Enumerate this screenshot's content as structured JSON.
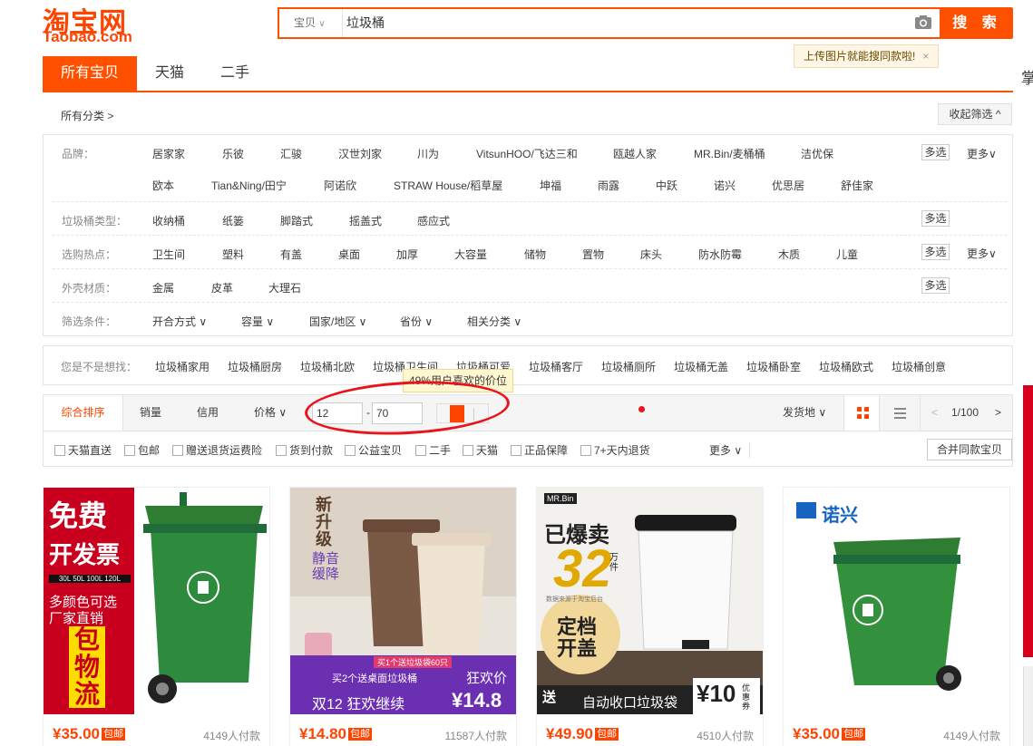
{
  "header": {
    "logo_cn": "淘宝网",
    "logo_en": "Taobao.com",
    "search_type": "宝贝",
    "search_value": "垃圾桶",
    "search_button": "搜 索",
    "upload_tip": "上传图片就能搜同款啦!",
    "tip_close": "×",
    "edge_char": "掌"
  },
  "tabs": [
    {
      "label": "所有宝贝",
      "active": true
    },
    {
      "label": "天猫",
      "active": false
    },
    {
      "label": "二手",
      "active": false
    }
  ],
  "filter": {
    "breadcrumb": "所有分类 >",
    "collapse_label": "收起筛选 ^",
    "multi_label": "多选",
    "more_label": "更多∨",
    "brand_label": "品牌：",
    "brands_row1": [
      "居家家",
      "乐彼",
      "汇骏",
      "汉世刘家",
      "川为",
      "VitsunHOO/飞达三和",
      "瓯越人家",
      "MR.Bin/麦桶桶",
      "洁优保"
    ],
    "brands_row2": [
      "欧本",
      "Tian&Ning/田宁",
      "阿诺欣",
      "STRAW House/稻草屋",
      "坤福",
      "雨露",
      "中跃",
      "诺兴",
      "优思居",
      "舒佳家"
    ],
    "type_label": "垃圾桶类型：",
    "types": [
      "收纳桶",
      "纸篓",
      "脚踏式",
      "摇盖式",
      "感应式"
    ],
    "hot_label": "选购热点：",
    "hots": [
      "卫生间",
      "塑料",
      "有盖",
      "桌面",
      "加厚",
      "大容量",
      "储物",
      "置物",
      "床头",
      "防水防霉",
      "木质",
      "儿童"
    ],
    "material_label": "外壳材质：",
    "materials": [
      "金属",
      "皮革",
      "大理石"
    ],
    "cond_label": "筛选条件：",
    "conds": [
      "开合方式 ∨",
      "容量 ∨",
      "国家/地区 ∨",
      "省份 ∨",
      "相关分类 ∨"
    ]
  },
  "suggest": {
    "label": "您是不是想找：",
    "items": [
      "垃圾桶家用",
      "垃圾桶厨房",
      "垃圾桶北欧",
      "垃圾桶卫生间",
      "垃圾桶可爱",
      "垃圾桶客厅",
      "垃圾桶厕所",
      "垃圾桶无盖",
      "垃圾桶卧室",
      "垃圾桶欧式",
      "垃圾桶创意"
    ]
  },
  "sort": {
    "items": [
      "综合排序",
      "销量",
      "信用",
      "价格 ∨"
    ],
    "price_min": "12",
    "price_dash": "-",
    "price_max": "70",
    "price_tip": "49%用户喜欢的价位",
    "ship_from": "发货地 ∨",
    "page": "1/100",
    "prev": "<",
    "next": ">",
    "checks": [
      "天猫直送",
      "包邮",
      "赠送退货运费险",
      "货到付款",
      "公益宝贝",
      "二手",
      "天猫",
      "正品保障",
      "7+天内退货"
    ],
    "more": "更多 ∨",
    "merge": "合并同款宝贝"
  },
  "products": [
    {
      "price": "¥35.00",
      "post": "包邮",
      "sales": "4149人付款",
      "img_text": [
        "免费",
        "开发票",
        "30L 50L 100L 120L",
        "多颜色可选",
        "厂家直销",
        "包",
        "物",
        "流"
      ]
    },
    {
      "price": "¥14.80",
      "post": "包邮",
      "sales": "11587人付款",
      "img_text": [
        "新",
        "升",
        "级",
        "静音",
        "缓降",
        "买1个送垃圾袋60只",
        "买2个送桌面垃圾桶",
        "狂欢价",
        "双12  狂欢继续",
        "¥14.8"
      ]
    },
    {
      "price": "¥49.90",
      "post": "包邮",
      "sales": "4510人付款",
      "img_text": [
        "MR.Bin",
        "已爆卖",
        "32",
        "万件",
        "数据来源于淘宝后台",
        "定档",
        "开盖",
        "送",
        "自动收口垃圾袋",
        "¥10",
        "优惠券"
      ]
    },
    {
      "price": "¥35.00",
      "post": "包邮",
      "sales": "4149人付款",
      "img_text": [
        "诺兴"
      ]
    }
  ],
  "colors": {
    "accent": "#ff5000",
    "price": "#ff4400",
    "annotation": "#e8131b",
    "bin_green": "#2e7d32"
  }
}
